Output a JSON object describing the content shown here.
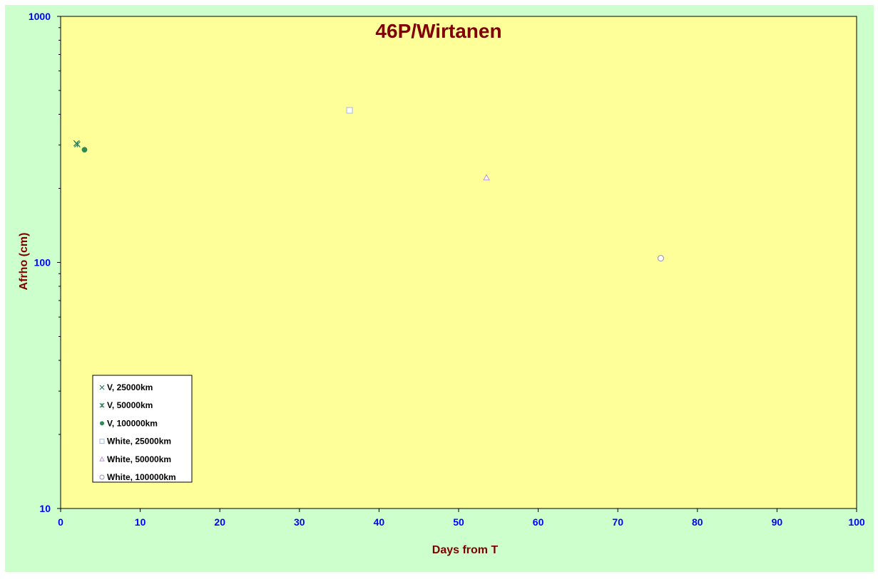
{
  "chart_data": {
    "type": "scatter",
    "title": "46P/Wirtanen",
    "xlabel": "Days from T",
    "ylabel": "Afrho (cm)",
    "xlim": [
      0,
      100
    ],
    "ylim": [
      10,
      1000
    ],
    "yscale": "log",
    "x_ticks": [
      "0",
      "10",
      "20",
      "30",
      "40",
      "50",
      "60",
      "70",
      "80",
      "90",
      "100"
    ],
    "y_ticks": [
      "10",
      "100",
      "1000"
    ],
    "grid": false,
    "legend_position": "bottom-left",
    "series": [
      {
        "name": "V, 25000km",
        "marker": "x",
        "color": "#2e7d5b",
        "points": [
          {
            "x": 2.0,
            "y": 305
          }
        ]
      },
      {
        "name": "V, 50000km",
        "marker": "star",
        "color": "#2e7d5b",
        "points": [
          {
            "x": 2.1,
            "y": 302
          }
        ]
      },
      {
        "name": "V, 100000km",
        "marker": "filled-circle",
        "color": "#2e8b57",
        "points": [
          {
            "x": 3.0,
            "y": 287
          }
        ]
      },
      {
        "name": "White, 25000km",
        "marker": "square",
        "color": "#aab8d8",
        "points": [
          {
            "x": 36.3,
            "y": 415
          }
        ]
      },
      {
        "name": "White, 50000km",
        "marker": "triangle",
        "color": "#c090d8",
        "points": [
          {
            "x": 53.5,
            "y": 221
          }
        ]
      },
      {
        "name": "White, 100000km",
        "marker": "circle",
        "color": "#9a8ab0",
        "points": [
          {
            "x": 75.4,
            "y": 104
          }
        ]
      }
    ]
  },
  "colors": {
    "outer_bg": "#ccffcc",
    "plot_bg": "#ffff99",
    "title": "#800000",
    "axis_title": "#800000",
    "tick_label": "#0000ff"
  }
}
